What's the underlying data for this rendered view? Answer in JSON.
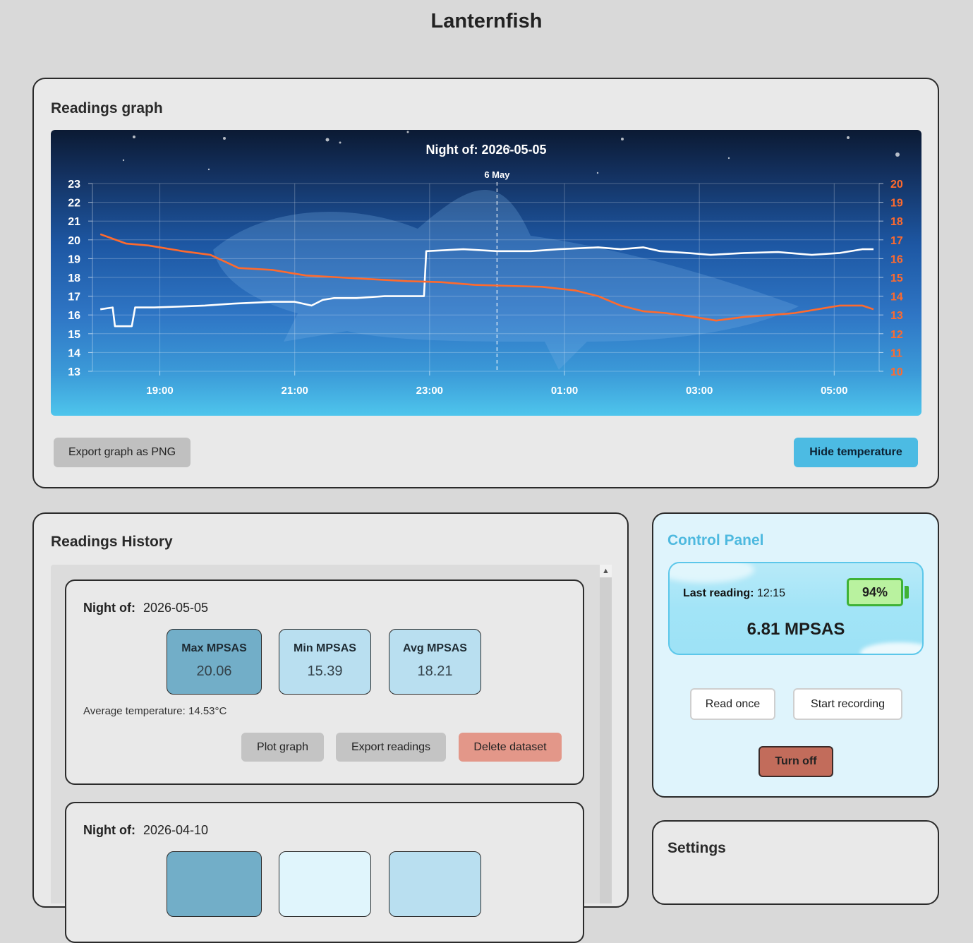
{
  "app": {
    "title": "Lanternfish"
  },
  "graph_card": {
    "title": "Readings graph",
    "export_label": "Export graph as PNG",
    "hide_temp_label": "Hide temperature"
  },
  "chart_data": {
    "type": "line",
    "title": "Night of: 2026-05-05",
    "date_marker": {
      "label": "6 May",
      "x": "00:00"
    },
    "x_tick_labels": [
      "19:00",
      "21:00",
      "23:00",
      "01:00",
      "03:00",
      "05:00"
    ],
    "y_left": {
      "ticks": [
        23,
        22,
        21,
        20,
        19,
        18,
        17,
        16,
        15,
        14,
        13
      ],
      "range": [
        13,
        23
      ],
      "color": "#ffffff"
    },
    "y_right": {
      "ticks": [
        20,
        19,
        18,
        17,
        16,
        15,
        14,
        13,
        12,
        11,
        10
      ],
      "range": [
        10,
        20
      ],
      "color": "#ff6a2d"
    },
    "grid": true,
    "series": [
      {
        "axis": "left",
        "color": "#ffffff",
        "x": [
          "18:07",
          "18:18",
          "18:20",
          "18:35",
          "18:38",
          "18:55",
          "19:20",
          "19:40",
          "20:05",
          "20:40",
          "21:00",
          "21:15",
          "21:25",
          "21:35",
          "21:55",
          "22:20",
          "22:55",
          "22:57",
          "23:30",
          "00:00",
          "00:30",
          "00:55",
          "01:30",
          "01:50",
          "02:10",
          "02:25",
          "02:50",
          "03:10",
          "03:40",
          "04:10",
          "04:40",
          "05:05",
          "05:25",
          "05:35"
        ],
        "y": [
          16.3,
          16.4,
          15.4,
          15.4,
          16.4,
          16.4,
          16.45,
          16.5,
          16.6,
          16.7,
          16.7,
          16.5,
          16.8,
          16.9,
          16.9,
          17.0,
          17.0,
          19.4,
          19.5,
          19.4,
          19.4,
          19.5,
          19.6,
          19.5,
          19.6,
          19.4,
          19.3,
          19.2,
          19.3,
          19.35,
          19.2,
          19.3,
          19.5,
          19.5
        ]
      },
      {
        "axis": "right",
        "color": "#ff6a2d",
        "x": [
          "18:07",
          "18:30",
          "18:50",
          "19:20",
          "19:45",
          "20:10",
          "20:40",
          "21:10",
          "21:40",
          "22:10",
          "22:40",
          "23:10",
          "23:40",
          "00:10",
          "00:40",
          "01:10",
          "01:30",
          "01:50",
          "02:10",
          "02:30",
          "02:55",
          "03:15",
          "03:40",
          "04:05",
          "04:25",
          "04:45",
          "05:05",
          "05:25",
          "05:35"
        ],
        "y": [
          17.3,
          16.8,
          16.7,
          16.4,
          16.2,
          15.5,
          15.4,
          15.1,
          15.0,
          14.9,
          14.8,
          14.75,
          14.6,
          14.55,
          14.5,
          14.3,
          14.0,
          13.5,
          13.2,
          13.1,
          12.9,
          12.7,
          12.9,
          13.0,
          13.1,
          13.3,
          13.5,
          13.5,
          13.3
        ]
      }
    ]
  },
  "history_card": {
    "title": "Readings History",
    "scroll_up_glyph": "▲",
    "nights": [
      {
        "label": "Night of:",
        "date": "2026-05-05",
        "max_label": "Max MPSAS",
        "max": "20.06",
        "min_label": "Min MPSAS",
        "min": "15.39",
        "avg_label": "Avg MPSAS",
        "avg": "18.21",
        "avg_temp": "Average temperature: 14.53°C",
        "plot_label": "Plot graph",
        "export_label": "Export readings",
        "delete_label": "Delete dataset"
      },
      {
        "label": "Night of:",
        "date": "2026-04-10"
      }
    ]
  },
  "control_panel": {
    "title": "Control Panel",
    "last_reading_label": "Last reading:",
    "last_reading_time": "12:15",
    "battery": "94%",
    "battery_level": 0.94,
    "mpsas": "6.81 MPSAS",
    "read_once_label": "Read once",
    "start_recording_label": "Start recording",
    "turn_off_label": "Turn off"
  },
  "settings": {
    "title": "Settings"
  }
}
